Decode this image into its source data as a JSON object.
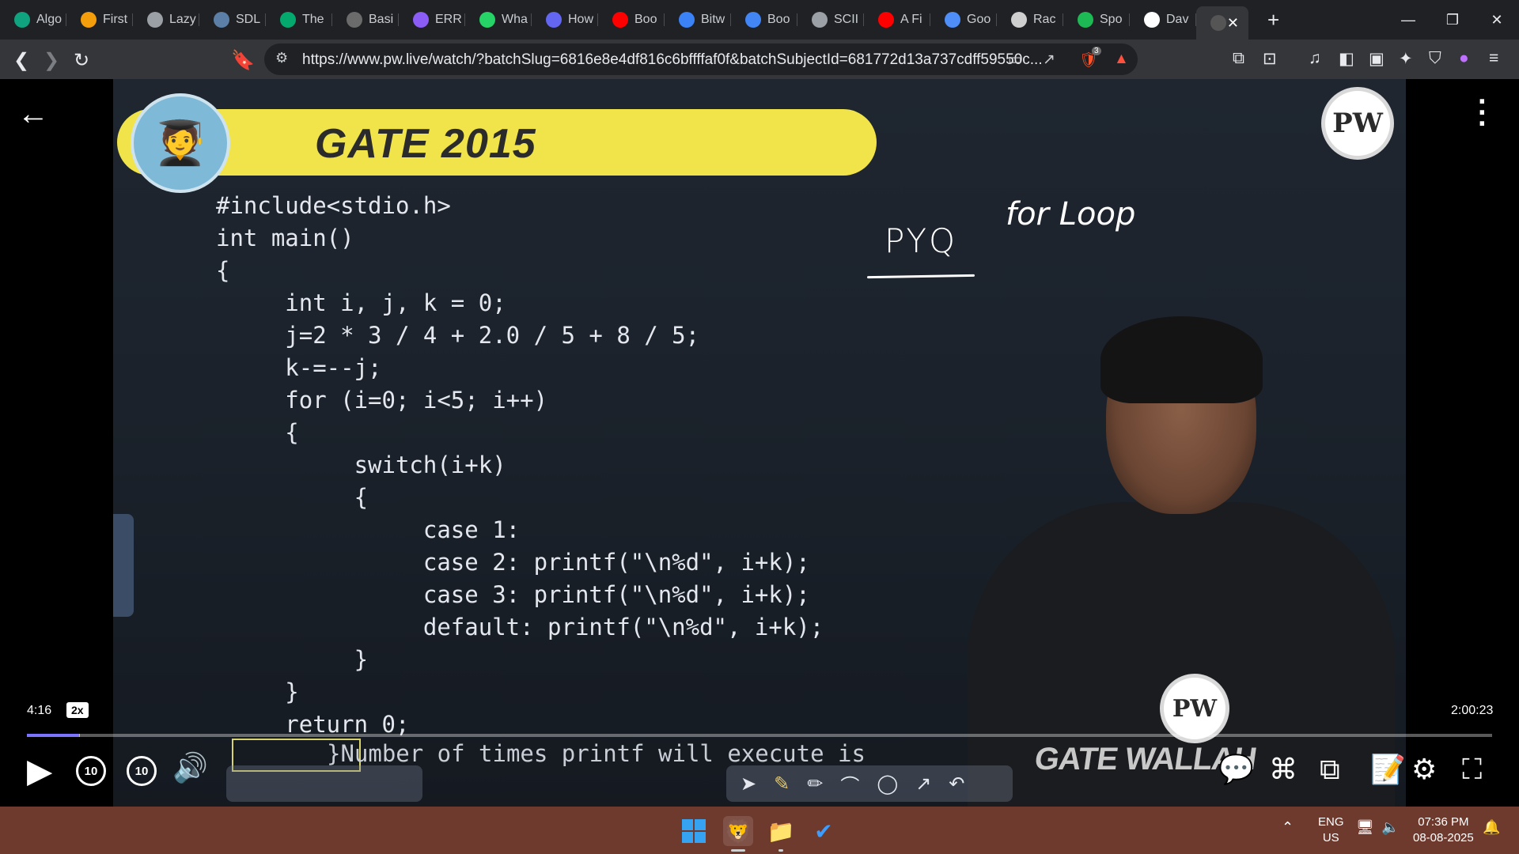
{
  "tabs": [
    {
      "title": "Algo",
      "icon": "chatgpt-icon",
      "color": "#10a37f"
    },
    {
      "title": "First",
      "icon": "lightning-icon",
      "color": "#f59e0b"
    },
    {
      "title": "Lazy",
      "icon": "globe-icon",
      "color": "#9aa0a6"
    },
    {
      "title": "SDL",
      "icon": "image-icon",
      "color": "#5b7fa6"
    },
    {
      "title": "The",
      "icon": "w3schools-icon",
      "color": "#04aa6d"
    },
    {
      "title": "Basi",
      "icon": "page-icon",
      "color": "#6b6b6b"
    },
    {
      "title": "ERR",
      "icon": "mushroom-icon",
      "color": "#8b5cf6"
    },
    {
      "title": "Wha",
      "icon": "whatsapp-icon",
      "color": "#25d366"
    },
    {
      "title": "How",
      "icon": "bookmark-icon",
      "color": "#6366f1"
    },
    {
      "title": "Boo",
      "icon": "youtube-icon",
      "color": "#ff0000"
    },
    {
      "title": "Bitw",
      "icon": "bitwise-icon",
      "color": "#3b82f6"
    },
    {
      "title": "Boo",
      "icon": "google-icon",
      "color": "#4285f4"
    },
    {
      "title": "SCII",
      "icon": "globe-icon",
      "color": "#9aa0a6"
    },
    {
      "title": "A Fi",
      "icon": "youtube-icon",
      "color": "#ff0000"
    },
    {
      "title": "Goo",
      "icon": "gemini-icon",
      "color": "#4f8ef7"
    },
    {
      "title": "Rac",
      "icon": "openai-icon",
      "color": "#cfcfcf"
    },
    {
      "title": "Spo",
      "icon": "spotify-icon",
      "color": "#1db954"
    },
    {
      "title": "Dav",
      "icon": "wikipedia-icon",
      "color": "#ffffff"
    }
  ],
  "active_tab": {
    "icon": "pw-icon",
    "close": "✕"
  },
  "address_bar": {
    "url": "https://www.pw.live/watch/?batchSlug=6816e8e4df816c6bffffaf0f&batchSubjectId=681772d13a737cdff59550c..."
  },
  "brave_badge": "3",
  "slide": {
    "banner_title": "GATE 2015",
    "code_lines": [
      "#include<stdio.h>",
      "int main()",
      "{",
      "     int i, j, k = 0;",
      "     j=2 * 3 / 4 + 2.0 / 5 + 8 / 5;",
      "     k-=--j;",
      "     for (i=0; i<5; i++)",
      "     {",
      "          switch(i+k)",
      "          {",
      "               case 1:",
      "               case 2: printf(\"\\n%d\", i+k);",
      "               case 3: printf(\"\\n%d\", i+k);",
      "               default: printf(\"\\n%d\", i+k);",
      "          }",
      "     }",
      "     return 0;"
    ],
    "question_line": "}Number of times printf will execute is",
    "handwriting_pyq": "PYQ",
    "handwriting_topic": "for Loop",
    "logo_text": "PW",
    "shirt_text": "GATE WALLAH"
  },
  "player": {
    "current_time": "4:16",
    "speed": "2x",
    "total_time": "2:00:23",
    "progress_fraction": 0.0355,
    "skip_back": "10",
    "skip_forward": "10"
  },
  "taskbar": {
    "language_top": "ENG",
    "language_bottom": "US",
    "time": "07:36 PM",
    "date": "08-08-2025"
  }
}
